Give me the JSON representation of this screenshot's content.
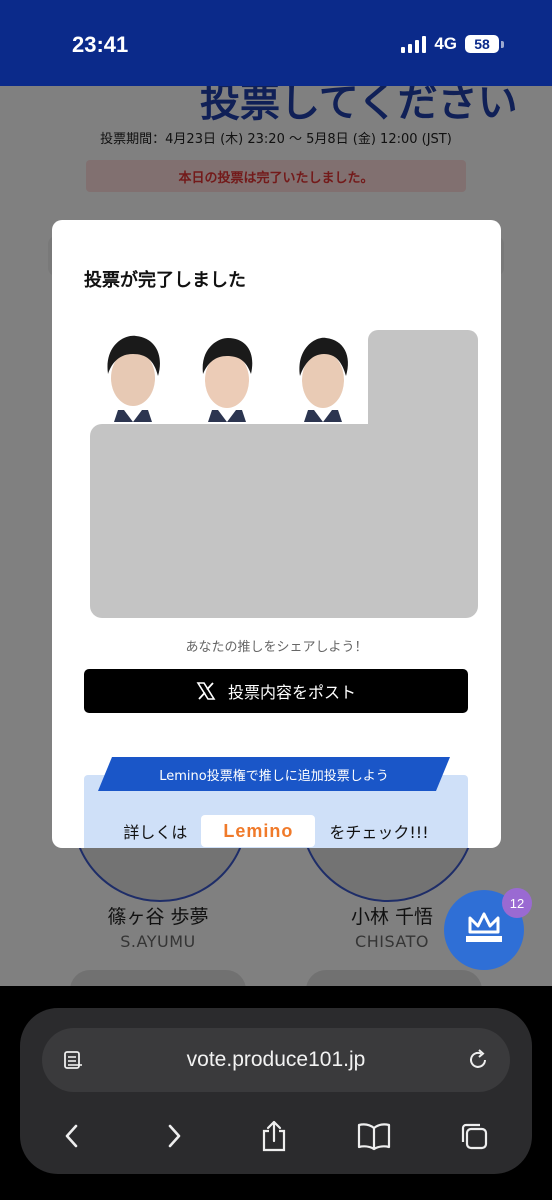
{
  "status_bar": {
    "time": "23:41",
    "network": "4G",
    "battery": "58"
  },
  "page": {
    "title": "投票してください",
    "vote_period": "投票期間：4月23日 (木) 23:20 〜 5月8日 (金) 12:00 (JST)",
    "done_banner": "本日の投票は完了いたしました。",
    "trainees": [
      {
        "name": "篠ヶ谷 歩夢",
        "roman": "S.AYUMU"
      },
      {
        "name": "小林 千悟",
        "roman": "CHISATO"
      }
    ],
    "crown_badge": "12"
  },
  "modal": {
    "title": "投票が完了しました",
    "share_hint": "あなたの推しをシェアしよう！",
    "post_button": "投票内容をポスト",
    "lemino_ribbon": "Lemino投票権で推しに追加投票しよう",
    "lemino_prefix": "詳しくは",
    "lemino_logo": "Lemino",
    "lemino_suffix": "をチェック!!!"
  },
  "browser": {
    "url": "vote.produce101.jp"
  }
}
